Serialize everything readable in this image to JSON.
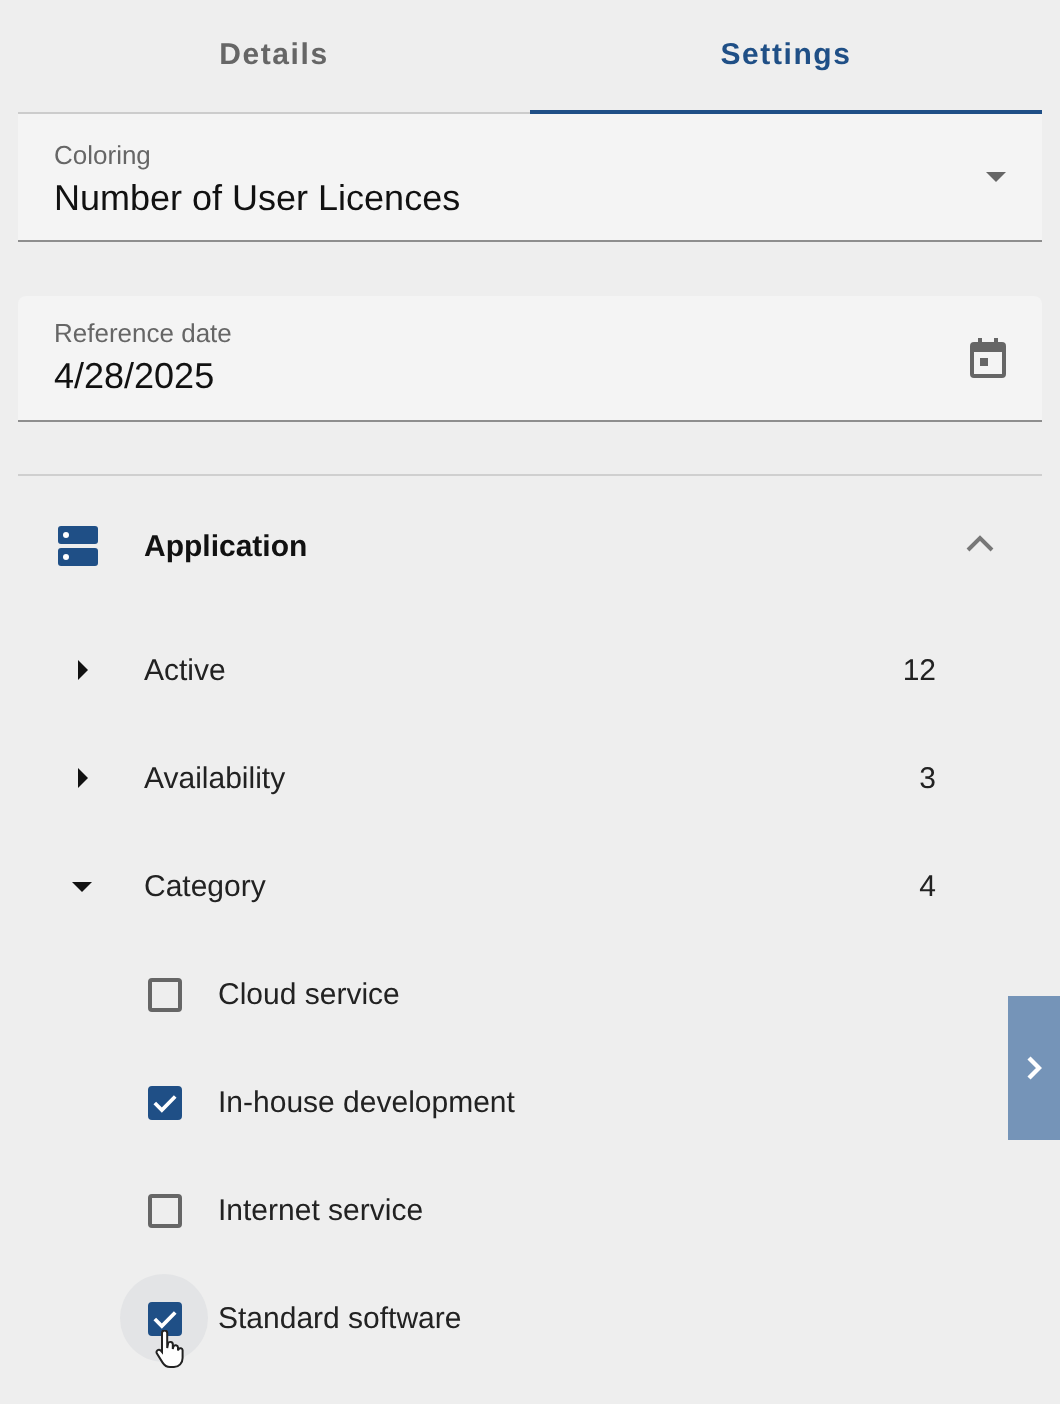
{
  "tabs": [
    {
      "label": "Details",
      "selected": false
    },
    {
      "label": "Settings",
      "selected": true
    }
  ],
  "coloring": {
    "label": "Coloring",
    "value": "Number of User Licences"
  },
  "reference_date": {
    "label": "Reference date",
    "value": "4/28/2025"
  },
  "section": {
    "title": "Application",
    "expanded": true,
    "groups": [
      {
        "label": "Active",
        "count": "12",
        "expanded": false
      },
      {
        "label": "Availability",
        "count": "3",
        "expanded": false
      },
      {
        "label": "Category",
        "count": "4",
        "expanded": true,
        "children": [
          {
            "label": "Cloud service",
            "checked": false,
            "hovered": false
          },
          {
            "label": "In-house development",
            "checked": true,
            "hovered": false
          },
          {
            "label": "Internet service",
            "checked": false,
            "hovered": false
          },
          {
            "label": "Standard software",
            "checked": true,
            "hovered": true
          }
        ]
      }
    ]
  }
}
